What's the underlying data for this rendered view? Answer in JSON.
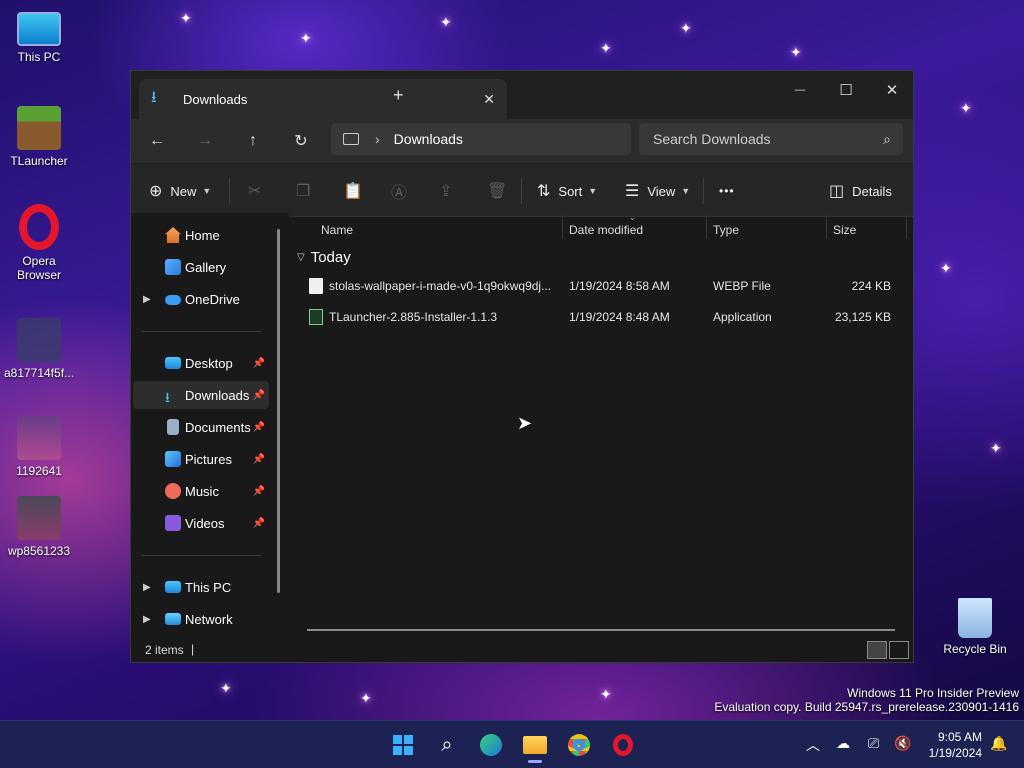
{
  "desktop": {
    "icons": [
      {
        "label": "This PC"
      },
      {
        "label": "TLauncher"
      },
      {
        "label": "Opera Browser"
      },
      {
        "label": "a817714f5f..."
      },
      {
        "label": "1192641"
      },
      {
        "label": "wp8561233"
      },
      {
        "label": "Recycle Bin"
      }
    ],
    "watermark": {
      "line1": "Windows 11 Pro Insider Preview",
      "line2": "Evaluation copy. Build 25947.rs_prerelease.230901-1416"
    }
  },
  "window": {
    "tab_title": "Downloads",
    "new_tab": "+",
    "controls": {
      "minimize": "—",
      "maximize": "☐",
      "close": "✕"
    },
    "address": {
      "segment": "Downloads"
    },
    "search": {
      "placeholder": "Search Downloads"
    },
    "toolbar": {
      "new_label": "New",
      "sort_label": "Sort",
      "view_label": "View",
      "more_label": "•••",
      "details_label": "Details"
    },
    "sidebar": {
      "items": [
        {
          "label": "Home"
        },
        {
          "label": "Gallery"
        },
        {
          "label": "OneDrive"
        },
        {
          "label": "Desktop"
        },
        {
          "label": "Downloads"
        },
        {
          "label": "Documents"
        },
        {
          "label": "Pictures"
        },
        {
          "label": "Music"
        },
        {
          "label": "Videos"
        },
        {
          "label": "This PC"
        },
        {
          "label": "Network"
        }
      ]
    },
    "columns": {
      "name": "Name",
      "date": "Date modified",
      "type": "Type",
      "size": "Size"
    },
    "group": {
      "label": "Today"
    },
    "files": [
      {
        "name": "stolas-wallpaper-i-made-v0-1q9okwq9dj...",
        "date": "1/19/2024 8:58 AM",
        "type": "WEBP File",
        "size": "224 KB"
      },
      {
        "name": "TLauncher-2.885-Installer-1.1.3",
        "date": "1/19/2024 8:48 AM",
        "type": "Application",
        "size": "23,125 KB"
      }
    ],
    "status": {
      "items_count": "2 items"
    }
  },
  "taskbar": {
    "clock": {
      "time": "9:05 AM",
      "date": "1/19/2024"
    }
  },
  "colors": {
    "accent": "#4cc2ff",
    "window_bg": "#191919",
    "taskbar_bg": "#1c2352"
  }
}
